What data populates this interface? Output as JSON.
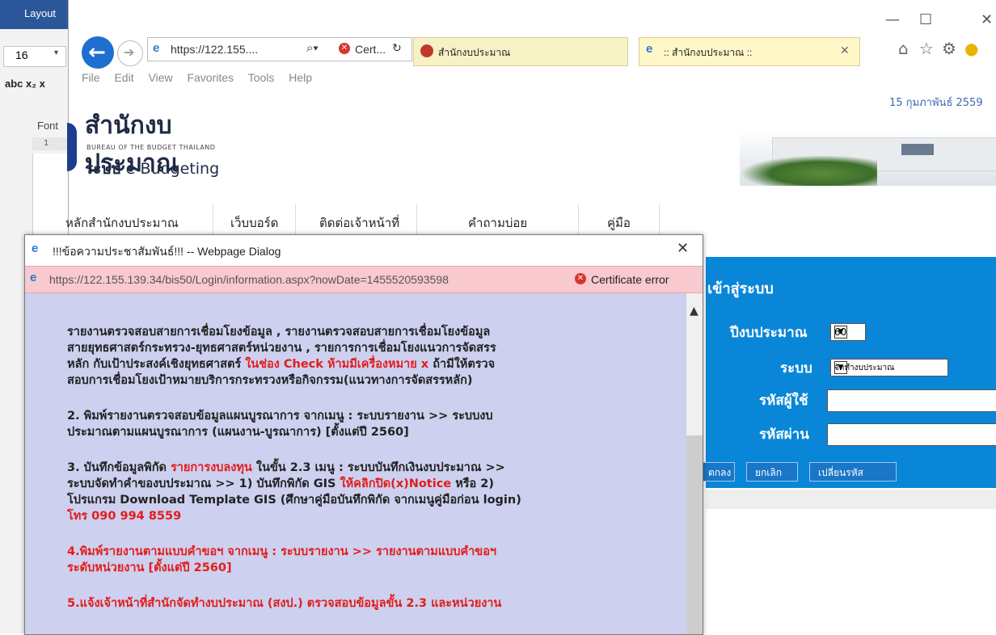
{
  "word": {
    "tab_label": "Layout",
    "font_size": "16",
    "format_row": "abc x₂ x",
    "font_group_label": "Font",
    "ruler_mark": "1"
  },
  "browser": {
    "address_url": "https://122.155....",
    "cert_label": "Cert...",
    "tab1_label": "สำนักงบประมาณ",
    "tab2_label": ":: สำนักงบประมาณ ::",
    "menu": [
      "File",
      "Edit",
      "View",
      "Favorites",
      "Tools",
      "Help"
    ]
  },
  "page": {
    "logo_thai": "สำนักงบประมาณ",
    "logo_english": "BUREAU OF THE BUDGET THAILAND",
    "logo_system_prefix": "ระบบ",
    "logo_system": "e-Budgeting",
    "header_date": "15 กุมภาพันธ์ 2559",
    "nav": [
      "หลักสำนักงบประมาณ",
      "เว็บบอร์ด",
      "ติดต่อเจ้าหน้าที่",
      "คำถามบ่อย",
      "คู่มือ"
    ]
  },
  "login": {
    "title": "เข้าสู่ระบบ",
    "year_label": "ปีงบประมาณ",
    "year_value": "60",
    "system_label": "ระบบ",
    "system_value": "จัดทำงบประมาณ",
    "user_label": "รหัสผู้ใช้",
    "pass_label": "รหัสผ่าน",
    "ok": "ตกลง",
    "cancel": "ยกเลิก",
    "change": "เปลี่ยนรหัส"
  },
  "dialog": {
    "title": "!!!ข้อความประชาสัมพันธ์!!! -- Webpage Dialog",
    "url": "https://122.155.139.34/bis50/Login/information.aspx?nowDate=1455520593598",
    "cert": "Certificate error",
    "para1_a": "รายงานตรวจสอบสายการเชื่อมโยงข้อมูล , รายงานตรวจสอบสายการเชื่อมโยงข้อมูล",
    "para1_b": "สายยุทธศาสตร์กระทรวง-ยุทธศาสตร์หน่วยงาน , รายการการเชื่อมโยงแนวการจัดสรร",
    "para1_c1": "หลัก กับเป้าประสงค์เชิงยุทธศาสตร์ ",
    "para1_c2": "ในช่อง Check ห้ามมีเครื่องหมาย x",
    "para1_c3": " ถ้ามีให้ตรวจ",
    "para1_d": "สอบการเชื่อมโยงเป้าหมายบริการกระทรวงหรือกิจกรรม(แนวทางการจัดสรรหลัก)",
    "para2_a": "2. พิมพ์รายงานตรวจสอบข้อมูลแผนบูรณาการ จากเมนู : ระบบรายงาน >> ระบบงบ",
    "para2_b": "ประมาณตามแผนบูรณาการ (แผนงาน-บูรณาการ) [ตั้งแต่ปี 2560]",
    "para3_a1": "3. บันทึกข้อมูลพิกัด ",
    "para3_a2": "รายการงบลงทุน",
    "para3_a3": " ในขั้น 2.3 เมนู : ระบบบันทึกเงินงบประมาณ >>",
    "para3_b1": "ระบบจัดทำคำของบประมาณ >> 1) บันทึกพิกัด GIS ",
    "para3_b2": "ให้คลิกปิด(x)Notice",
    "para3_b3": " หรือ 2)",
    "para3_c": "โปรแกรม Download Template GIS (ศึกษาคู่มือบันทึกพิกัด จากเมนูคู่มือก่อน login)",
    "para3_d": "โทร 090 994 8559",
    "para4_a": "4.พิมพ์รายงานตามแบบคำขอฯ จากเมนู : ระบบรายงาน >> รายงานตามแบบคำขอฯ",
    "para4_b": "ระดับหน่วยงาน [ตั้งแต่ปี 2560]",
    "para5_a": "5.แจ้งเจ้าหน้าที่สำนักจัดทำงบประมาณ (สงป.) ตรวจสอบข้อมูลขั้น 2.3 และหน่วยงาน"
  }
}
